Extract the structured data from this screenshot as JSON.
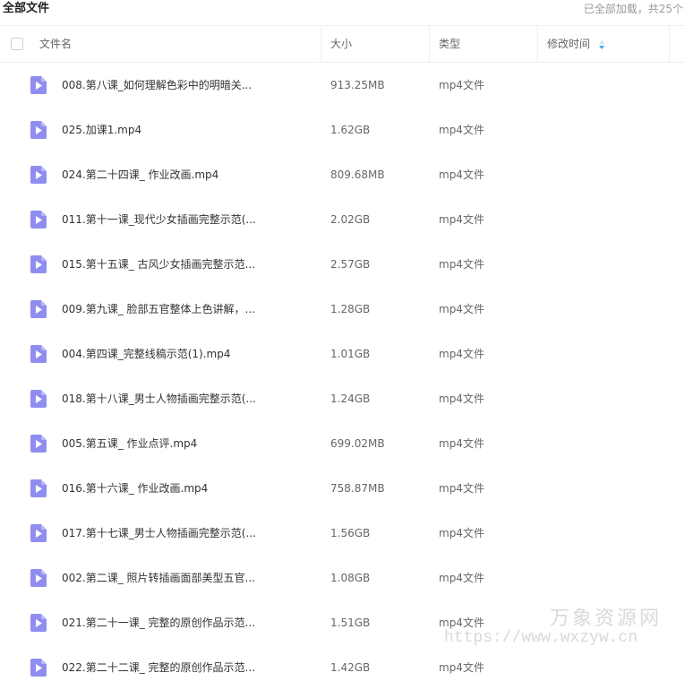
{
  "top": {
    "title": "全部文件",
    "loaded_status": "已全部加载，共25个"
  },
  "columns": {
    "name": "文件名",
    "size": "大小",
    "type": "类型",
    "modified": "修改时间"
  },
  "colors": {
    "file_icon": "#8f8ef0",
    "sort_icon": "#39a7f0"
  },
  "files": [
    {
      "name": "008.第八课_如何理解色彩中的明暗关...",
      "size": "913.25MB",
      "type": "mp4文件"
    },
    {
      "name": "025.加课1.mp4",
      "size": "1.62GB",
      "type": "mp4文件"
    },
    {
      "name": "024.第二十四课_ 作业改画.mp4",
      "size": "809.68MB",
      "type": "mp4文件"
    },
    {
      "name": "011.第十一课_现代少女插画完整示范(...",
      "size": "2.02GB",
      "type": "mp4文件"
    },
    {
      "name": "015.第十五课_ 古风少女插画完整示范...",
      "size": "2.57GB",
      "type": "mp4文件"
    },
    {
      "name": "009.第九课_ 脸部五官整体上色讲解，...",
      "size": "1.28GB",
      "type": "mp4文件"
    },
    {
      "name": "004.第四课_完整线稿示范(1).mp4",
      "size": "1.01GB",
      "type": "mp4文件"
    },
    {
      "name": "018.第十八课_男士人物插画完整示范(...",
      "size": "1.24GB",
      "type": "mp4文件"
    },
    {
      "name": "005.第五课_ 作业点评.mp4",
      "size": "699.02MB",
      "type": "mp4文件"
    },
    {
      "name": "016.第十六课_ 作业改画.mp4",
      "size": "758.87MB",
      "type": "mp4文件"
    },
    {
      "name": "017.第十七课_男士人物插画完整示范(...",
      "size": "1.56GB",
      "type": "mp4文件"
    },
    {
      "name": "002.第二课_ 照片转插画面部美型五官...",
      "size": "1.08GB",
      "type": "mp4文件"
    },
    {
      "name": "021.第二十一课_ 完整的原创作品示范...",
      "size": "1.51GB",
      "type": "mp4文件"
    },
    {
      "name": "022.第二十二课_ 完整的原创作品示范...",
      "size": "1.42GB",
      "type": "mp4文件"
    }
  ],
  "watermark": {
    "site_name": "万象资源网",
    "url": "https://www.wxzyw.cn"
  }
}
